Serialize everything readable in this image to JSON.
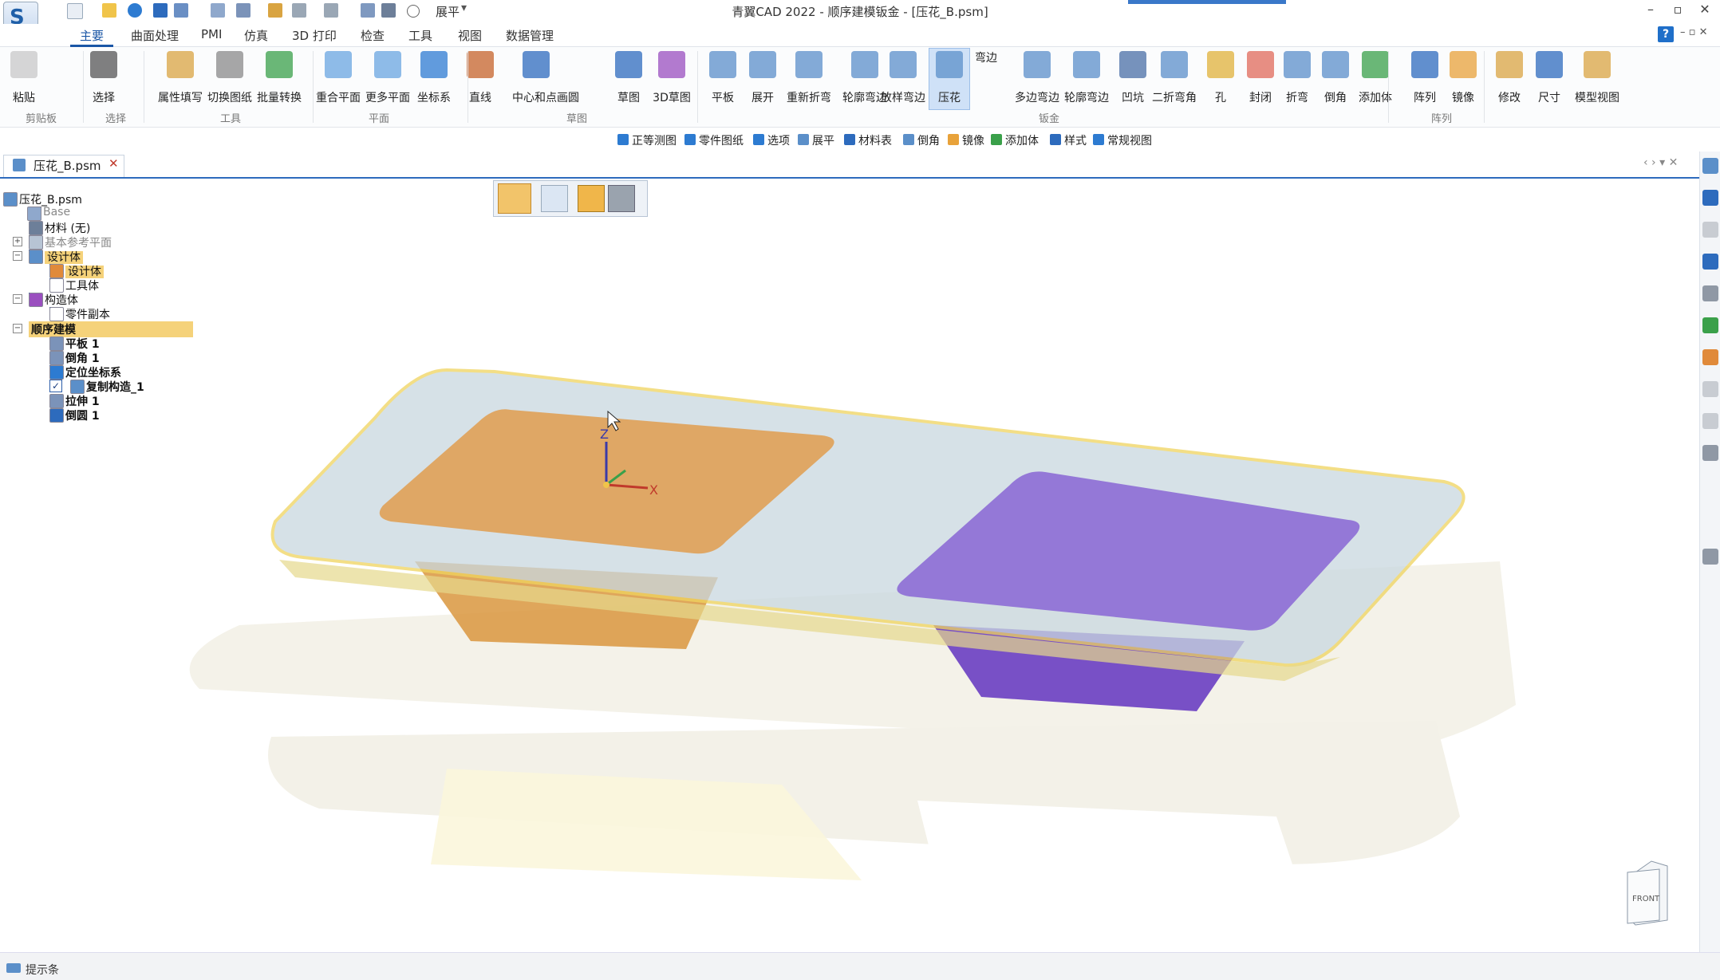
{
  "window": {
    "title": "青翼CAD 2022 - 顺序建模钣金 - [压花_B.psm]",
    "logo_text": "S",
    "quick_access_label": "展平",
    "min": "–",
    "max": "▫",
    "close": "✕"
  },
  "menu_tabs": [
    "主要",
    "曲面处理",
    "PMI",
    "仿真",
    "3D 打印",
    "检查",
    "工具",
    "视图",
    "数据管理"
  ],
  "ribbon": {
    "buttons": [
      {
        "label": "粘贴",
        "color": "#c8c8c8"
      },
      {
        "label": "选择",
        "color": "#555555"
      },
      {
        "label": "属性填写",
        "color": "#d9a441"
      },
      {
        "label": "切换图纸",
        "color": "#8a8a8a"
      },
      {
        "label": "批量转换",
        "color": "#3aa04a"
      },
      {
        "label": "重合平面",
        "color": "#6aa6e0"
      },
      {
        "label": "更多平面",
        "color": "#6aa6e0"
      },
      {
        "label": "坐标系",
        "color": "#2d7bd1"
      },
      {
        "label": "直线",
        "color": "#c5632a"
      },
      {
        "label": "中心和点画圆",
        "color": "#2d6bbd"
      },
      {
        "label": "草图",
        "color": "#2d6bbd"
      },
      {
        "label": "3D草图",
        "color": "#9a4fbf"
      },
      {
        "label": "平板",
        "color": "#5b8fc9"
      },
      {
        "label": "展开",
        "color": "#5b8fc9"
      },
      {
        "label": "重新折弯",
        "color": "#5b8fc9"
      },
      {
        "label": "轮廓弯边",
        "color": "#5b8fc9"
      },
      {
        "label": "放样弯边",
        "color": "#5b8fc9"
      },
      {
        "label": "压花",
        "color": "#5b8fc9"
      },
      {
        "label": "多边弯边",
        "color": "#5b8fc9"
      },
      {
        "label": "轮廓弯边",
        "color": "#5b8fc9"
      },
      {
        "label": "凹坑",
        "color": "#4a6fa5"
      },
      {
        "label": "二折弯角",
        "color": "#5b8fc9"
      },
      {
        "label": "孔",
        "color": "#e0b23a"
      },
      {
        "label": "封闭",
        "color": "#e06a5a"
      },
      {
        "label": "折弯",
        "color": "#5b8fc9"
      },
      {
        "label": "倒角",
        "color": "#5b8fc9"
      },
      {
        "label": "添加体",
        "color": "#3aa04a"
      },
      {
        "label": "阵列",
        "color": "#2d6bbd"
      },
      {
        "label": "镜像",
        "color": "#e8a23a"
      },
      {
        "label": "修改",
        "color": "#d9a441"
      },
      {
        "label": "尺寸",
        "color": "#2d6bbd"
      },
      {
        "label": "模型视图",
        "color": "#d9a441"
      }
    ],
    "small_label": "弯边",
    "groups": [
      "剪贴板",
      "选择",
      "工具",
      "平面",
      "草图",
      "钣金",
      "阵列"
    ]
  },
  "command_bar": [
    {
      "label": "正等测图",
      "color": "#2d7bd1"
    },
    {
      "label": "零件图纸",
      "color": "#2d7bd1"
    },
    {
      "label": "选项",
      "color": "#2d7bd1"
    },
    {
      "label": "展平",
      "color": "#5b8fc9"
    },
    {
      "label": "材料表",
      "color": "#2d6bbd"
    },
    {
      "label": "倒角",
      "color": "#5b8fc9"
    },
    {
      "label": "镜像",
      "color": "#e8a23a"
    },
    {
      "label": "添加体",
      "color": "#3aa04a"
    },
    {
      "label": "样式",
      "color": "#2d6bbd"
    },
    {
      "label": "常规视图",
      "color": "#2d7bd1"
    }
  ],
  "document_tab": {
    "label": "压花_B.psm",
    "close": "✕"
  },
  "tree": [
    {
      "label": "压花_B.psm",
      "type": "root"
    },
    {
      "label": "Base",
      "type": "dim"
    },
    {
      "label": "材料 (无)",
      "type": "plain"
    },
    {
      "label": "基本参考平面",
      "type": "dim"
    },
    {
      "label": "设计体",
      "type": "highlight"
    },
    {
      "label": "设计体",
      "type": "highlight"
    },
    {
      "label": "工具体",
      "type": "plain"
    },
    {
      "label": "构造体",
      "type": "plain"
    },
    {
      "label": "零件副本",
      "type": "plain"
    },
    {
      "label": "顺序建模",
      "type": "highlight"
    },
    {
      "label": "平板 1",
      "type": "bold"
    },
    {
      "label": "倒角 1",
      "type": "bold"
    },
    {
      "label": "定位坐标系",
      "type": "bold"
    },
    {
      "label": "复制构造_1",
      "type": "bold"
    },
    {
      "label": "拉伸 1",
      "type": "bold"
    },
    {
      "label": "倒圆 1",
      "type": "bold"
    }
  ],
  "view_cube_label": "FRONT",
  "axes": {
    "z": "Z",
    "x": "X"
  },
  "status_bar": "提示条",
  "colors": {
    "accent": "#1a56a6",
    "orange_face": "#e0a25a",
    "purple_face": "#8e6fd6",
    "plate": "#cdd9e2",
    "edge": "#f0d25a"
  }
}
